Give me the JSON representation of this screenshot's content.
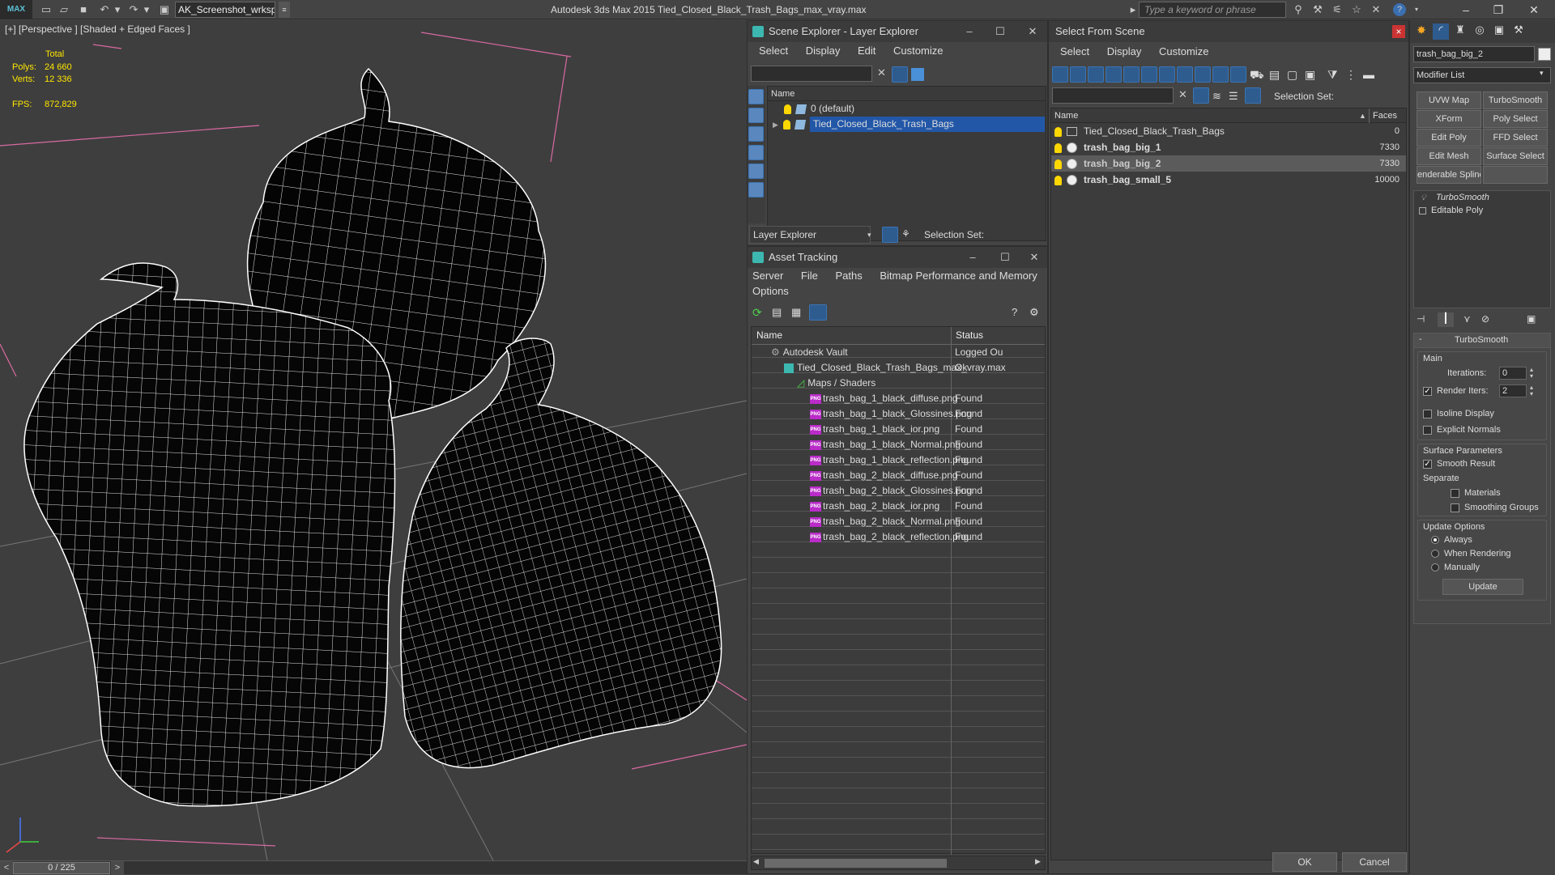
{
  "app": {
    "logo": "MAX",
    "workspace": "AK_Screenshot_wrksp",
    "title": "Autodesk 3ds Max  2015     Tied_Closed_Black_Trash_Bags_max_vray.max",
    "search_placeholder": "Type a keyword or phrase"
  },
  "viewport": {
    "label": "[+] [Perspective ] [Shaded + Edged Faces ]",
    "stats": {
      "total_label": "Total",
      "polys_label": "Polys:",
      "polys": "24 660",
      "verts_label": "Verts:",
      "verts": "12 336",
      "fps_label": "FPS:",
      "fps": "872,829"
    }
  },
  "timeline": {
    "value": "0 / 225",
    "prev": "<",
    "next": ">"
  },
  "scene_explorer": {
    "title": "Scene Explorer - Layer Explorer",
    "menu": [
      "Select",
      "Display",
      "Edit",
      "Customize"
    ],
    "col_name": "Name",
    "rows": [
      "0 (default)",
      "Tied_Closed_Black_Trash_Bags"
    ],
    "footer_combo": "Layer Explorer",
    "selection_set": "Selection Set:"
  },
  "asset_tracking": {
    "title": "Asset Tracking",
    "menu": [
      "Server",
      "File",
      "Paths",
      "Bitmap Performance and Memory"
    ],
    "menu2": "Options",
    "col_name": "Name",
    "col_status": "Status",
    "rows": [
      {
        "name": "Autodesk Vault",
        "status": "Logged Ou"
      },
      {
        "name": "Tied_Closed_Black_Trash_Bags_max_vray.max",
        "status": "Ok"
      },
      {
        "name": "Maps / Shaders",
        "status": ""
      },
      {
        "name": "trash_bag_1_black_diffuse.png",
        "status": "Found"
      },
      {
        "name": "trash_bag_1_black_Glossines.png",
        "status": "Found"
      },
      {
        "name": "trash_bag_1_black_ior.png",
        "status": "Found"
      },
      {
        "name": "trash_bag_1_black_Normal.png",
        "status": "Found"
      },
      {
        "name": "trash_bag_1_black_reflection.png",
        "status": "Found"
      },
      {
        "name": "trash_bag_2_black_diffuse.png",
        "status": "Found"
      },
      {
        "name": "trash_bag_2_black_Glossines.png",
        "status": "Found"
      },
      {
        "name": "trash_bag_2_black_ior.png",
        "status": "Found"
      },
      {
        "name": "trash_bag_2_black_Normal.png",
        "status": "Found"
      },
      {
        "name": "trash_bag_2_black_reflection.png",
        "status": "Found"
      }
    ]
  },
  "select_from_scene": {
    "title": "Select From Scene",
    "close": "×",
    "menu": [
      "Select",
      "Display",
      "Customize"
    ],
    "selection_set": "Selection Set:",
    "col_name": "Name",
    "col_faces": "Faces",
    "rows": [
      {
        "name": "Tied_Closed_Black_Trash_Bags",
        "faces": "0"
      },
      {
        "name": "trash_bag_big_1",
        "faces": "7330"
      },
      {
        "name": "trash_bag_big_2",
        "faces": "7330"
      },
      {
        "name": "trash_bag_small_5",
        "faces": "10000"
      }
    ],
    "ok": "OK",
    "cancel": "Cancel"
  },
  "command_panel": {
    "object_name": "trash_bag_big_2",
    "modifier_list": "Modifier List",
    "buttons": [
      "UVW Map",
      "TurboSmooth",
      "XForm",
      "Poly Select",
      "Edit Poly",
      "FFD Select",
      "Edit Mesh",
      "Surface Select",
      "enderable Spline",
      ""
    ],
    "stack": [
      "TurboSmooth",
      "Editable Poly"
    ],
    "rollout": "TurboSmooth",
    "main": "Main",
    "iterations_label": "Iterations:",
    "iterations": "0",
    "render_iters_label": "Render Iters:",
    "render_iters": "2",
    "isoline": "Isoline Display",
    "explicit": "Explicit Normals",
    "surface": "Surface Parameters",
    "smooth": "Smooth Result",
    "separate": "Separate",
    "materials": "Materials",
    "smoothing": "Smoothing Groups",
    "update_options": "Update Options",
    "always": "Always",
    "when_rendering": "When Rendering",
    "manually": "Manually",
    "update": "Update"
  }
}
